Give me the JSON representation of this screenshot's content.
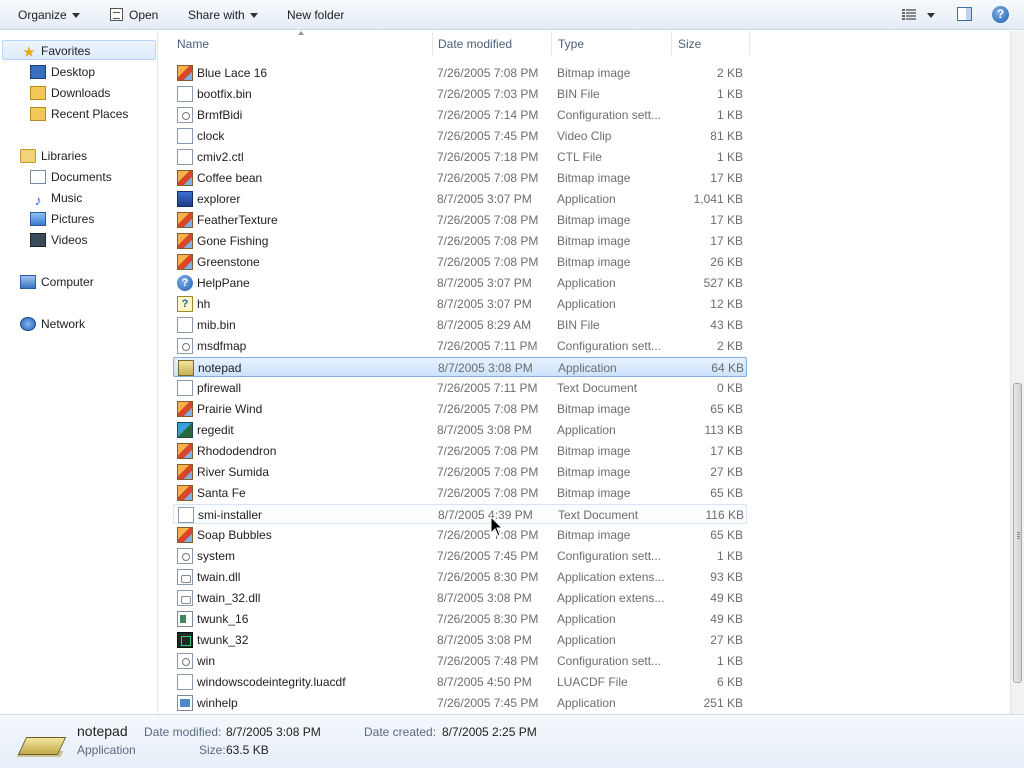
{
  "toolbar": {
    "organize_label": "Organize",
    "open_label": "Open",
    "share_label": "Share with",
    "new_folder_label": "New folder",
    "help_glyph": "?"
  },
  "nav": {
    "favorites": {
      "label": "Favorites",
      "icon": "star-icon"
    },
    "favorites_items": [
      {
        "label": "Desktop",
        "icon": "desktop-icon"
      },
      {
        "label": "Downloads",
        "icon": "downloads-icon"
      },
      {
        "label": "Recent Places",
        "icon": "recent-places-icon"
      }
    ],
    "libraries": {
      "label": "Libraries",
      "icon": "libraries-icon"
    },
    "libraries_items": [
      {
        "label": "Documents",
        "icon": "documents-icon"
      },
      {
        "label": "Music",
        "icon": "music-icon"
      },
      {
        "label": "Pictures",
        "icon": "pictures-icon"
      },
      {
        "label": "Videos",
        "icon": "videos-icon"
      }
    ],
    "computer": {
      "label": "Computer",
      "icon": "computer-icon"
    },
    "network": {
      "label": "Network",
      "icon": "network-icon"
    }
  },
  "columns": {
    "name": "Name",
    "date": "Date modified",
    "type": "Type",
    "size": "Size"
  },
  "files": [
    {
      "name": "Blue Lace 16",
      "date": "7/26/2005 7:08 PM",
      "type": "Bitmap image",
      "size": "2 KB",
      "icon": "bitmap-icon"
    },
    {
      "name": "bootfix.bin",
      "date": "7/26/2005 7:03 PM",
      "type": "BIN File",
      "size": "1 KB",
      "icon": "file-icon"
    },
    {
      "name": "BrmfBidi",
      "date": "7/26/2005 7:14 PM",
      "type": "Configuration sett...",
      "size": "1 KB",
      "icon": "config-icon"
    },
    {
      "name": "clock",
      "date": "7/26/2005 7:45 PM",
      "type": "Video Clip",
      "size": "81 KB",
      "icon": "file-icon"
    },
    {
      "name": "cmiv2.ctl",
      "date": "7/26/2005 7:18 PM",
      "type": "CTL File",
      "size": "1 KB",
      "icon": "file-icon"
    },
    {
      "name": "Coffee bean",
      "date": "7/26/2005 7:08 PM",
      "type": "Bitmap image",
      "size": "17 KB",
      "icon": "bitmap-icon"
    },
    {
      "name": "explorer",
      "date": "8/7/2005 3:07 PM",
      "type": "Application",
      "size": "1,041 KB",
      "icon": "explorer-icon"
    },
    {
      "name": "FeatherTexture",
      "date": "7/26/2005 7:08 PM",
      "type": "Bitmap image",
      "size": "17 KB",
      "icon": "bitmap-icon"
    },
    {
      "name": "Gone Fishing",
      "date": "7/26/2005 7:08 PM",
      "type": "Bitmap image",
      "size": "17 KB",
      "icon": "bitmap-icon"
    },
    {
      "name": "Greenstone",
      "date": "7/26/2005 7:08 PM",
      "type": "Bitmap image",
      "size": "26 KB",
      "icon": "bitmap-icon"
    },
    {
      "name": "HelpPane",
      "date": "8/7/2005 3:07 PM",
      "type": "Application",
      "size": "527 KB",
      "icon": "help-icon"
    },
    {
      "name": "hh",
      "date": "8/7/2005 3:07 PM",
      "type": "Application",
      "size": "12 KB",
      "icon": "hh-icon"
    },
    {
      "name": "mib.bin",
      "date": "8/7/2005 8:29 AM",
      "type": "BIN File",
      "size": "43 KB",
      "icon": "file-icon"
    },
    {
      "name": "msdfmap",
      "date": "7/26/2005 7:11 PM",
      "type": "Configuration sett...",
      "size": "2 KB",
      "icon": "config-icon"
    },
    {
      "name": "notepad",
      "date": "8/7/2005 3:08 PM",
      "type": "Application",
      "size": "64 KB",
      "icon": "notepad-icon"
    },
    {
      "name": "pfirewall",
      "date": "7/26/2005 7:11 PM",
      "type": "Text Document",
      "size": "0 KB",
      "icon": "file-icon"
    },
    {
      "name": "Prairie Wind",
      "date": "7/26/2005 7:08 PM",
      "type": "Bitmap image",
      "size": "65 KB",
      "icon": "bitmap-icon"
    },
    {
      "name": "regedit",
      "date": "8/7/2005 3:08 PM",
      "type": "Application",
      "size": "113 KB",
      "icon": "regedit-icon"
    },
    {
      "name": "Rhododendron",
      "date": "7/26/2005 7:08 PM",
      "type": "Bitmap image",
      "size": "17 KB",
      "icon": "bitmap-icon"
    },
    {
      "name": "River Sumida",
      "date": "7/26/2005 7:08 PM",
      "type": "Bitmap image",
      "size": "27 KB",
      "icon": "bitmap-icon"
    },
    {
      "name": "Santa Fe",
      "date": "7/26/2005 7:08 PM",
      "type": "Bitmap image",
      "size": "65 KB",
      "icon": "bitmap-icon"
    },
    {
      "name": "smi-installer",
      "date": "8/7/2005 4:39 PM",
      "type": "Text Document",
      "size": "116 KB",
      "icon": "file-icon"
    },
    {
      "name": "Soap Bubbles",
      "date": "7/26/2005 7:08 PM",
      "type": "Bitmap image",
      "size": "65 KB",
      "icon": "bitmap-icon"
    },
    {
      "name": "system",
      "date": "7/26/2005 7:45 PM",
      "type": "Configuration sett...",
      "size": "1 KB",
      "icon": "config-icon"
    },
    {
      "name": "twain.dll",
      "date": "7/26/2005 8:30 PM",
      "type": "Application extens...",
      "size": "93 KB",
      "icon": "dll-icon"
    },
    {
      "name": "twain_32.dll",
      "date": "8/7/2005 3:08 PM",
      "type": "Application extens...",
      "size": "49 KB",
      "icon": "dll-icon"
    },
    {
      "name": "twunk_16",
      "date": "7/26/2005 8:30 PM",
      "type": "Application",
      "size": "49 KB",
      "icon": "twunk16-icon"
    },
    {
      "name": "twunk_32",
      "date": "8/7/2005 3:08 PM",
      "type": "Application",
      "size": "27 KB",
      "icon": "twunk32-icon"
    },
    {
      "name": "win",
      "date": "7/26/2005 7:48 PM",
      "type": "Configuration sett...",
      "size": "1 KB",
      "icon": "config-icon"
    },
    {
      "name": "windowscodeintegrity.luacdf",
      "date": "8/7/2005 4:50 PM",
      "type": "LUACDF File",
      "size": "6 KB",
      "icon": "file-icon"
    },
    {
      "name": "winhelp",
      "date": "7/26/2005 7:45 PM",
      "type": "Application",
      "size": "251 KB",
      "icon": "winhelp-icon"
    }
  ],
  "selected_index": 14,
  "hover_index": 21,
  "details": {
    "name": "notepad",
    "type": "Application",
    "date_modified_label": "Date modified:",
    "date_modified_value": "8/7/2005 3:08 PM",
    "size_label": "Size:",
    "size_value": "63.5 KB",
    "date_created_label": "Date created:",
    "date_created_value": "8/7/2005 2:25 PM"
  },
  "colors": {
    "selection_border": "#84acdd",
    "selection_fill": "#cbe2fb",
    "toolbar_bg": "#e4ecf6",
    "meta_text": "#6d6d6d"
  }
}
